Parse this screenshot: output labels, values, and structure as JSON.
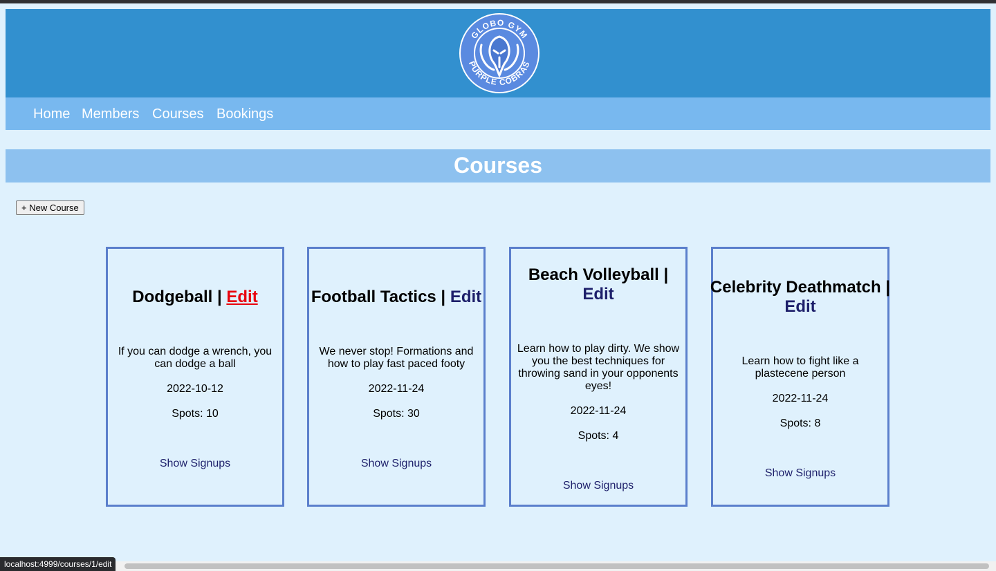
{
  "header": {
    "logo_text_top": "GLOBO GYM",
    "logo_text_bottom": "PURPLE COBRAS"
  },
  "nav": {
    "items": [
      {
        "label": "Home"
      },
      {
        "label": "Members"
      },
      {
        "label": "Courses"
      },
      {
        "label": "Bookings"
      }
    ]
  },
  "page": {
    "title": "Courses",
    "new_button": "+ New Course"
  },
  "courses": [
    {
      "name": "Dodgeball",
      "edit": "Edit",
      "description": "If you can dodge a wrench, you can dodge a ball",
      "date": "2022-10-12",
      "spots": "Spots: 10",
      "signups": "Show Signups"
    },
    {
      "name": "Football Tactics",
      "edit": "Edit",
      "description": "We never stop! Formations and how to play fast paced footy",
      "date": "2022-11-24",
      "spots": "Spots: 30",
      "signups": "Show Signups"
    },
    {
      "name": "Beach Volleyball",
      "edit": "Edit",
      "description": "Learn how to play dirty. We show you the best techniques for throwing sand in your opponents eyes!",
      "date": "2022-11-24",
      "spots": "Spots: 4",
      "signups": "Show Signups"
    },
    {
      "name": "Celebrity Deathmatch",
      "edit": "Edit",
      "description": "Learn how to fight like a plastecene person",
      "date": "2022-11-24",
      "spots": "Spots: 8",
      "signups": "Show Signups"
    }
  ],
  "status_bar": {
    "url": "localhost:4999/courses/1/edit"
  },
  "colors": {
    "header": "#3290cf",
    "nav": "#78b8ef",
    "title_bar": "#8dc1ef",
    "page_bg": "#dff1fd",
    "card_border": "#5b7fcc",
    "link": "#1d1f6a",
    "link_active": "#e8050f"
  }
}
